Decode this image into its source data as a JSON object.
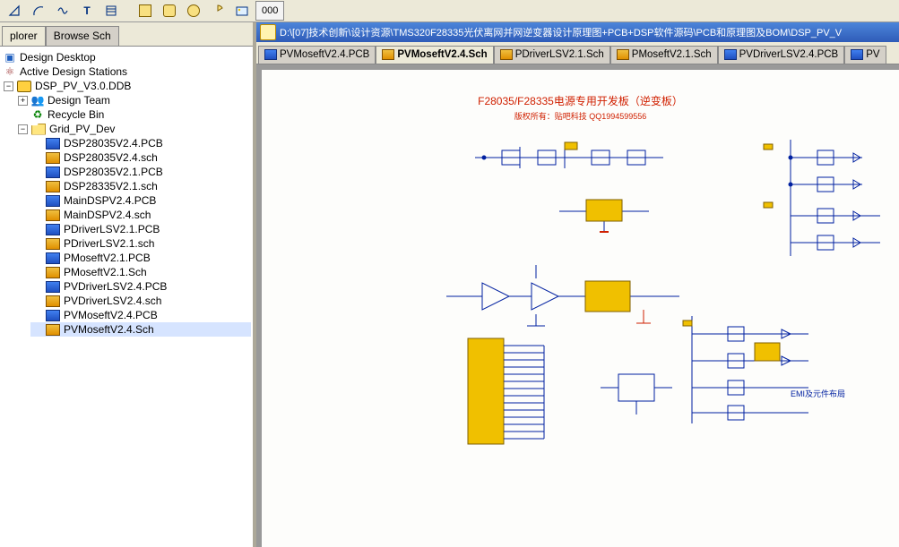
{
  "leftTabs": {
    "active": "plorer",
    "other": "Browse Sch"
  },
  "tree": {
    "root": "Design Desktop",
    "stations": "Active Design Stations",
    "ddb": "DSP_PV_V3.0.DDB",
    "team": "Design Team",
    "recycle": "Recycle Bin",
    "project": "Grid_PV_Dev",
    "files": [
      {
        "label": "DSP28035V2.4.PCB",
        "type": "pcb"
      },
      {
        "label": "DSP28035V2.4.sch",
        "type": "sch"
      },
      {
        "label": "DSP28035V2.1.PCB",
        "type": "pcb"
      },
      {
        "label": "DSP28335V2.1.sch",
        "type": "sch"
      },
      {
        "label": "MainDSPV2.4.PCB",
        "type": "pcb"
      },
      {
        "label": "MainDSPV2.4.sch",
        "type": "sch"
      },
      {
        "label": "PDriverLSV2.1.PCB",
        "type": "pcb"
      },
      {
        "label": "PDriverLSV2.1.sch",
        "type": "sch"
      },
      {
        "label": "PMoseftV2.1.PCB",
        "type": "pcb"
      },
      {
        "label": "PMoseftV2.1.Sch",
        "type": "sch"
      },
      {
        "label": "PVDriverLSV2.4.PCB",
        "type": "pcb"
      },
      {
        "label": "PVDriverLSV2.4.sch",
        "type": "sch"
      },
      {
        "label": "PVMoseftV2.4.PCB",
        "type": "pcb"
      },
      {
        "label": "PVMoseftV2.4.Sch",
        "type": "sch"
      }
    ]
  },
  "windowTitle": "D:\\[07]技术创新\\设计资源\\TMS320F28335光伏离网并网逆变器设计原理图+PCB+DSP软件源码\\PCB和原理图及BOM\\DSP_PV_V",
  "docTabs": [
    {
      "label": "PVMoseftV2.4.PCB",
      "type": "pcb",
      "active": false
    },
    {
      "label": "PVMoseftV2.4.Sch",
      "type": "sch",
      "active": true
    },
    {
      "label": "PDriverLSV2.1.Sch",
      "type": "sch",
      "active": false
    },
    {
      "label": "PMoseftV2.1.Sch",
      "type": "sch",
      "active": false
    },
    {
      "label": "PVDriverLSV2.4.PCB",
      "type": "pcb",
      "active": false
    },
    {
      "label": "PV",
      "type": "pcb",
      "active": false
    }
  ],
  "schematic": {
    "title": "F28035/F28335电源专用开发板（逆变板）",
    "subtitle": "版权所有：贴吧科技 QQ1994599556",
    "note": "EMI及元件布局"
  },
  "toolbar": {
    "textTool": "T",
    "frameTool": "▦",
    "arrayTool": "000"
  }
}
